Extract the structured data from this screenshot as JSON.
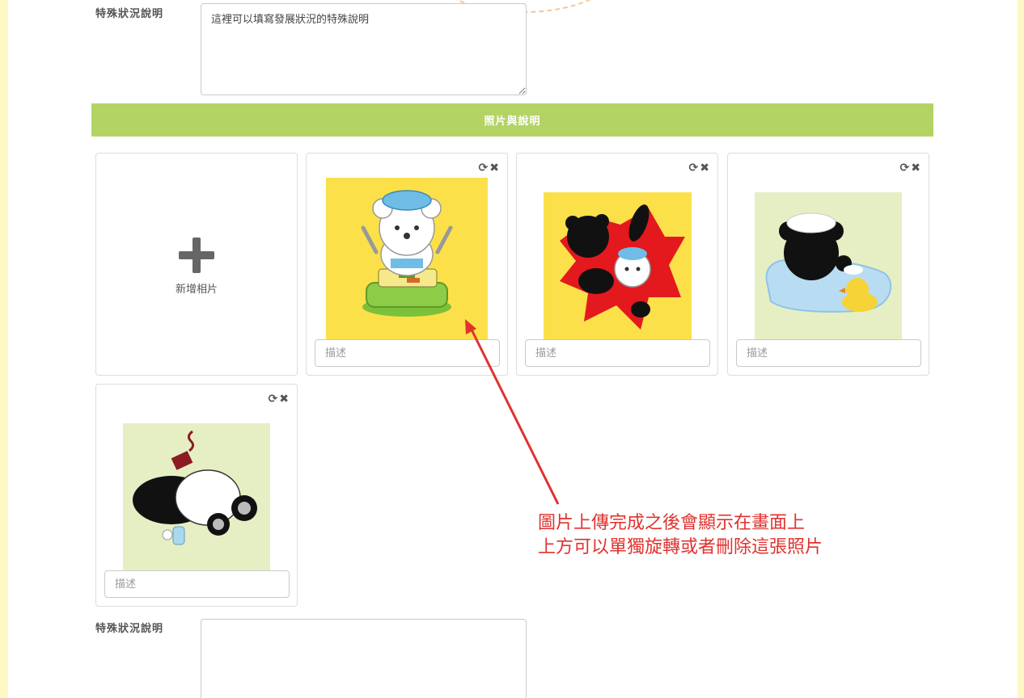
{
  "top_field": {
    "label": "特殊狀況說明",
    "value": "這裡可以填寫發展狀況的特殊說明"
  },
  "section": {
    "title": "照片與說明"
  },
  "add_photo": {
    "label": "新增相片"
  },
  "photos": [
    {
      "desc_placeholder": "描述",
      "rotate_icon": "rotate-icon",
      "delete_icon": "close-icon"
    },
    {
      "desc_placeholder": "描述",
      "rotate_icon": "rotate-icon",
      "delete_icon": "close-icon"
    },
    {
      "desc_placeholder": "描述",
      "rotate_icon": "rotate-icon",
      "delete_icon": "close-icon"
    },
    {
      "desc_placeholder": "描述",
      "rotate_icon": "rotate-icon",
      "delete_icon": "close-icon"
    }
  ],
  "bottom_field": {
    "label": "特殊狀況說明",
    "value": ""
  },
  "annotation": {
    "line1": "圖片上傳完成之後會顯示在畫面上",
    "line2": "上方可以單獨旋轉或者刪除這張照片"
  },
  "colors": {
    "section_bar": "#b3d465",
    "annotation_red": "#e0322e",
    "page_border": "#fdf8c4"
  }
}
